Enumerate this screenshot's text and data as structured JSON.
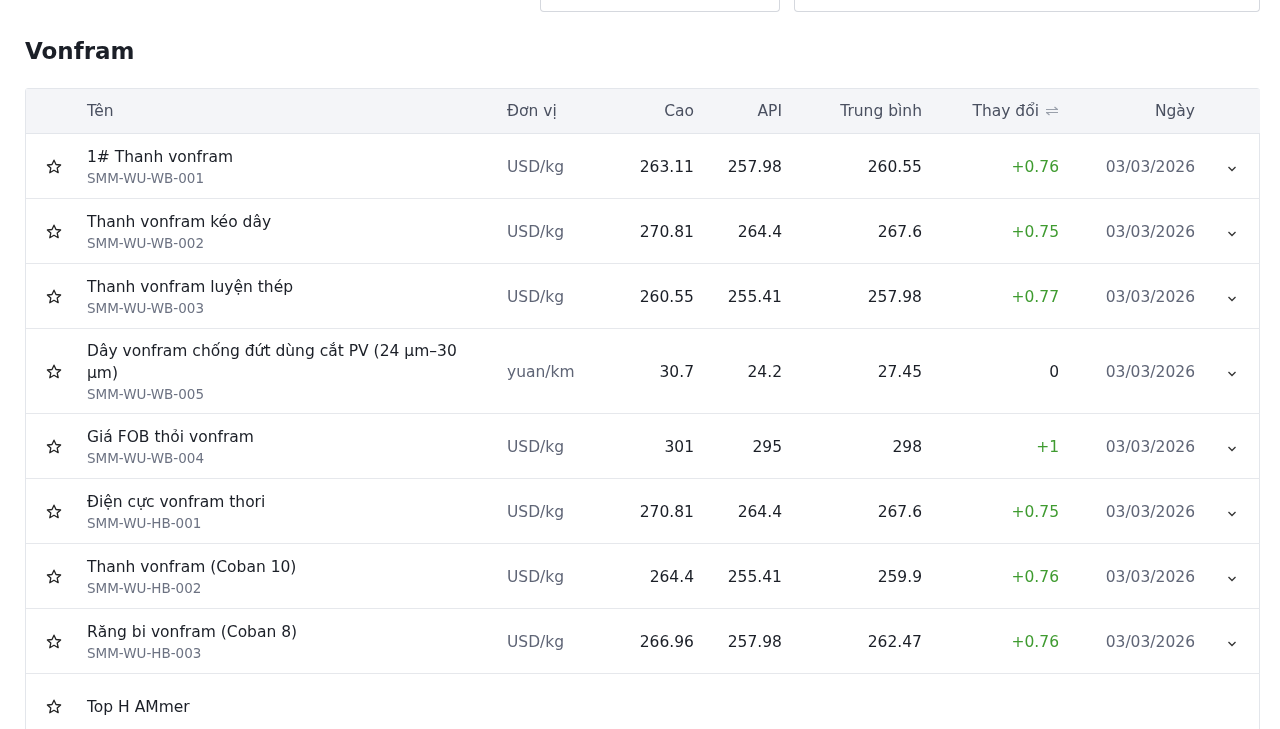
{
  "title": "Vonfram",
  "table": {
    "columns": [
      {
        "label": "Tên"
      },
      {
        "label": "Đơn vị"
      },
      {
        "label": "Cao"
      },
      {
        "label": "API"
      },
      {
        "label": "Trung bình"
      },
      {
        "label": "Thay đổi",
        "sortable": true
      },
      {
        "label": "Ngày"
      }
    ],
    "rows": [
      {
        "name": "1# Thanh vonfram",
        "code": "SMM-WU-WB-001",
        "unit": "USD/kg",
        "high": "263.11",
        "api": "257.98",
        "average": "260.55",
        "change": "+0.76",
        "color": "#3f9b30",
        "date": "03/03/2026",
        "favorite": false
      },
      {
        "name": "Thanh vonfram kéo dây",
        "code": "SMM-WU-WB-002",
        "unit": "USD/kg",
        "high": "270.81",
        "api": "264.4",
        "average": "267.6",
        "change": "+0.75",
        "color": "#3f9b30",
        "date": "03/03/2026",
        "favorite": false
      },
      {
        "name": "Thanh vonfram luyện thép",
        "code": "SMM-WU-WB-003",
        "unit": "USD/kg",
        "high": "260.55",
        "api": "255.41",
        "average": "257.98",
        "change": "+0.77",
        "color": "#3f9b30",
        "date": "03/03/2026",
        "favorite": false
      },
      {
        "name": "Dây vonfram chống đứt dùng cắt PV (24 µm–30 µm)",
        "code": "SMM-WU-WB-005",
        "unit": "yuan/km",
        "high": "30.7",
        "api": "24.2",
        "average": "27.45",
        "change": "0",
        "color": "#1b1f27",
        "date": "03/03/2026",
        "favorite": false
      },
      {
        "name": "Giá FOB thỏi vonfram",
        "code": "SMM-WU-WB-004",
        "unit": "USD/kg",
        "high": "301",
        "api": "295",
        "average": "298",
        "change": "+1",
        "color": "#3f9b30",
        "date": "03/03/2026",
        "favorite": false
      },
      {
        "name": "Điện cực vonfram thori",
        "code": "SMM-WU-HB-001",
        "unit": "USD/kg",
        "high": "270.81",
        "api": "264.4",
        "average": "267.6",
        "change": "+0.75",
        "color": "#3f9b30",
        "date": "03/03/2026",
        "favorite": false
      },
      {
        "name": "Thanh vonfram (Coban 10)",
        "code": "SMM-WU-HB-002",
        "unit": "USD/kg",
        "high": "264.4",
        "api": "255.41",
        "average": "259.9",
        "change": "+0.76",
        "color": "#3f9b30",
        "date": "03/03/2026",
        "favorite": false
      },
      {
        "name": "Răng bi vonfram (Coban 8)",
        "code": "SMM-WU-HB-003",
        "unit": "USD/kg",
        "high": "266.96",
        "api": "257.98",
        "average": "262.47",
        "change": "+0.76",
        "color": "#3f9b30",
        "date": "03/03/2026",
        "favorite": false
      },
      {
        "name": "Top H AMmer",
        "favorite": false
      }
    ]
  }
}
